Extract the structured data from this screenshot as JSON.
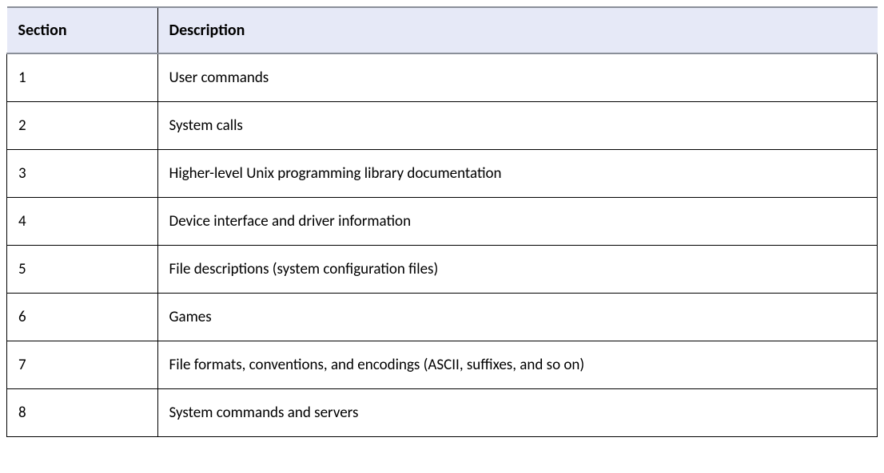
{
  "table": {
    "headers": {
      "section": "Section",
      "description": "Description"
    },
    "rows": [
      {
        "section": "1",
        "description": "User commands"
      },
      {
        "section": "2",
        "description": "System calls"
      },
      {
        "section": "3",
        "description": "Higher-level Unix programming library documentation"
      },
      {
        "section": "4",
        "description": "Device interface and driver information"
      },
      {
        "section": "5",
        "description": "File descriptions (system configuration files)"
      },
      {
        "section": "6",
        "description": "Games"
      },
      {
        "section": "7",
        "description": "File formats, conventions, and encodings (ASCII, suffixes, and so on)"
      },
      {
        "section": "8",
        "description": "System commands and servers"
      }
    ]
  }
}
